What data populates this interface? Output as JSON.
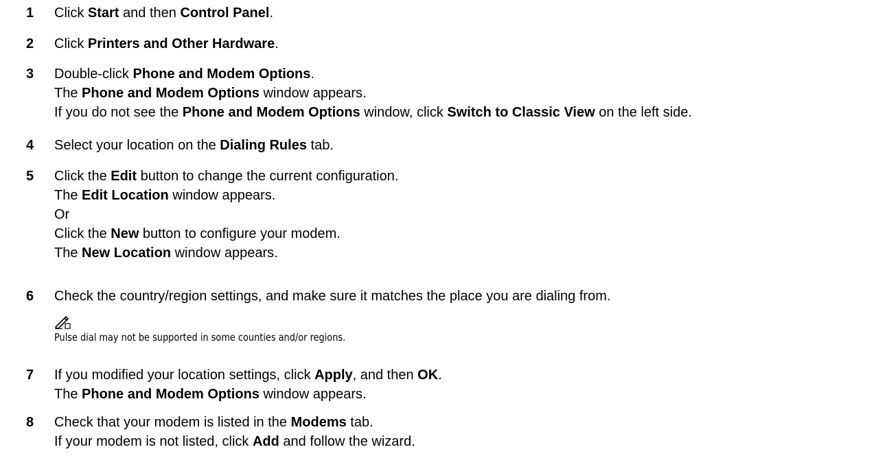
{
  "steps": [
    {
      "number": "1",
      "lines": [
        [
          "Click ",
          {
            "b": "Start"
          },
          " and then ",
          {
            "b": "Control Panel"
          },
          "."
        ]
      ]
    },
    {
      "number": "2",
      "lines": [
        [
          "Click ",
          {
            "b": "Printers and Other Hardware"
          },
          "."
        ]
      ]
    },
    {
      "number": "3",
      "lines": [
        [
          "Double-click ",
          {
            "b": "Phone and Modem Options"
          },
          "."
        ],
        [
          "The ",
          {
            "b": "Phone and Modem Options"
          },
          " window appears."
        ],
        [
          "If you do not see the ",
          {
            "b": "Phone and Modem Options"
          },
          " window, click ",
          {
            "b": "Switch to Classic View"
          },
          " on the left side."
        ]
      ]
    },
    {
      "number": "4",
      "lines": [
        [
          "Select your location on the ",
          {
            "b": "Dialing Rules"
          },
          " tab."
        ]
      ]
    },
    {
      "number": "5",
      "lines": [
        [
          "Click the ",
          {
            "b": "Edit"
          },
          " button to change the current configuration."
        ],
        [
          "The ",
          {
            "b": "Edit Location"
          },
          " window appears."
        ],
        [
          "Or"
        ],
        [
          "Click the ",
          {
            "b": "New"
          },
          " button to configure your modem."
        ],
        [
          "The ",
          {
            "b": "New Location"
          },
          " window appears."
        ]
      ]
    },
    {
      "number": "6",
      "lines": [
        [
          "Check the country/region settings, and make sure it matches the place you are dialing from."
        ]
      ]
    },
    {
      "number": "7",
      "lines": [
        [
          "If you modified your location settings, click ",
          {
            "b": "Apply"
          },
          ", and then ",
          {
            "b": "OK"
          },
          "."
        ],
        [
          "The ",
          {
            "b": "Phone and Modem Options"
          },
          " window appears."
        ]
      ]
    },
    {
      "number": "8",
      "lines": [
        [
          "Check that your modem is listed in the ",
          {
            "b": "Modems"
          },
          " tab."
        ],
        [
          "If your modem is not listed, click ",
          {
            "b": "Add"
          },
          " and follow the wizard."
        ]
      ]
    }
  ],
  "note": {
    "icon": "note-pencil-icon",
    "text": "Pulse dial may not be supported in some counties and/or regions."
  }
}
